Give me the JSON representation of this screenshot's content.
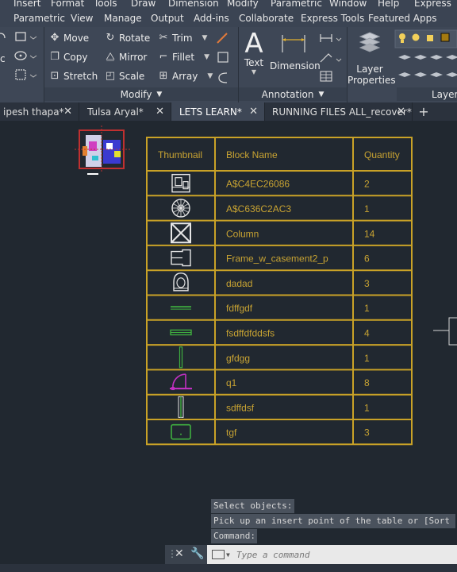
{
  "menu_bar": [
    "Insert",
    "Format",
    "Tools",
    "Draw",
    "Dimension",
    "Modify",
    "Parametric",
    "Window",
    "Help",
    "Express"
  ],
  "ribbon_tabs": [
    "Parametric",
    "View",
    "Manage",
    "Output",
    "Add-ins",
    "Collaborate",
    "Express Tools",
    "Featured Apps"
  ],
  "modify_panel": {
    "title": "Modify",
    "buttons": [
      {
        "label": "Move",
        "icon": "move-icon"
      },
      {
        "label": "Rotate",
        "icon": "rotate-icon"
      },
      {
        "label": "Trim",
        "icon": "trim-icon"
      },
      {
        "label": "Copy",
        "icon": "copy-icon"
      },
      {
        "label": "Mirror",
        "icon": "mirror-icon"
      },
      {
        "label": "Fillet",
        "icon": "fillet-icon"
      },
      {
        "label": "Stretch",
        "icon": "stretch-icon"
      },
      {
        "label": "Scale",
        "icon": "scale-icon"
      },
      {
        "label": "Array",
        "icon": "array-icon"
      }
    ]
  },
  "annotation_panel": {
    "title": "Annotation",
    "text_label": "Text",
    "dimension_label": "Dimension"
  },
  "layers_panel": {
    "layer_properties_line1": "Layer",
    "layer_properties_line2": "Properties",
    "title": "Layers"
  },
  "doc_tabs": [
    {
      "label": "ipesh thapa*",
      "active": false
    },
    {
      "label": "Tulsa Aryal*",
      "active": false
    },
    {
      "label": "LETS LEARN*",
      "active": true
    },
    {
      "label": "RUNNING FILES ALL_recover*",
      "active": false
    }
  ],
  "block_table": {
    "headers": [
      "Thumbnail",
      "Block Name",
      "Quantity"
    ],
    "rows": [
      {
        "name": "A$C4EC26086",
        "qty": "2",
        "thumb": "block-a-icon"
      },
      {
        "name": "A$C636C2AC3",
        "qty": "1",
        "thumb": "circle-hatch-icon"
      },
      {
        "name": "Column",
        "qty": "14",
        "thumb": "column-icon"
      },
      {
        "name": "Frame_w_casement2_p",
        "qty": "6",
        "thumb": "frame-icon"
      },
      {
        "name": "dadad",
        "qty": "3",
        "thumb": "toilet-icon"
      },
      {
        "name": "fdffgdf",
        "qty": "1",
        "thumb": "line-green-icon"
      },
      {
        "name": "fsdffdfddsfs",
        "qty": "4",
        "thumb": "double-line-green-icon"
      },
      {
        "name": "gfdgg",
        "qty": "1",
        "thumb": "vertical-bar-green-icon"
      },
      {
        "name": "q1",
        "qty": "8",
        "thumb": "door-swing-icon"
      },
      {
        "name": "sdffdsf",
        "qty": "1",
        "thumb": "vertical-double-bar-icon"
      },
      {
        "name": "tgf",
        "qty": "3",
        "thumb": "rounded-rect-icon"
      }
    ]
  },
  "command_history": [
    "Select objects:",
    "Pick up an insert point of the table or [Sort",
    "Command:"
  ],
  "command_input": {
    "placeholder": "Type a command"
  },
  "colors": {
    "table_gold": "#c9a227",
    "text_gold": "#c8a332",
    "canvas_bg": "#212830",
    "ribbon_bg": "#3e4756"
  }
}
